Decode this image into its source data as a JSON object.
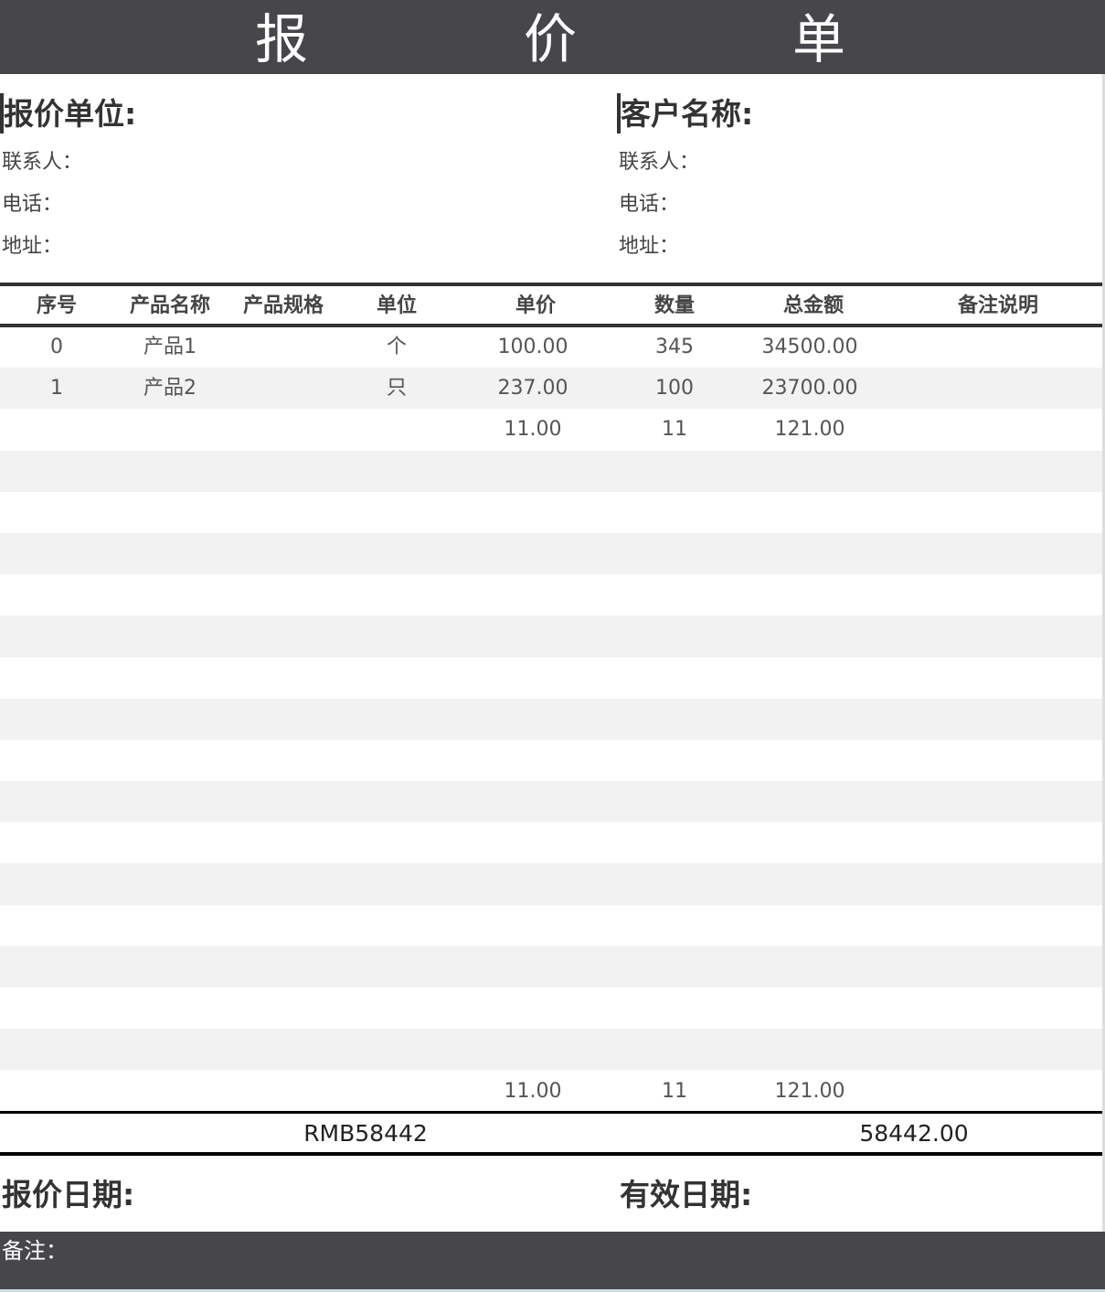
{
  "title": {
    "chars": [
      "报",
      "价",
      "单"
    ]
  },
  "quoter": {
    "heading": "报价单位:",
    "contact_label": "联系人：",
    "phone_label": "电话：",
    "address_label": "地址："
  },
  "customer": {
    "heading": "客户名称:",
    "contact_label": "联系人：",
    "phone_label": "电话：",
    "address_label": "地址："
  },
  "table": {
    "headers": {
      "index": "序号",
      "name": "产品名称",
      "spec": "产品规格",
      "unit": "单位",
      "price": "单价",
      "qty": "数量",
      "amount": "总金额",
      "notes": "备注说明"
    },
    "rows": [
      {
        "index": "0",
        "name": "产品1",
        "spec": "",
        "unit": "个",
        "price": "100.00",
        "qty": "345",
        "amount": "34500.00",
        "notes": ""
      },
      {
        "index": "1",
        "name": "产品2",
        "spec": "",
        "unit": "只",
        "price": "237.00",
        "qty": "100",
        "amount": "23700.00",
        "notes": ""
      },
      {
        "index": "",
        "name": "",
        "spec": "",
        "unit": "",
        "price": "11.00",
        "qty": "11",
        "amount": "121.00",
        "notes": ""
      },
      {
        "index": "",
        "name": "",
        "spec": "",
        "unit": "",
        "price": "",
        "qty": "",
        "amount": "",
        "notes": ""
      },
      {
        "index": "",
        "name": "",
        "spec": "",
        "unit": "",
        "price": "",
        "qty": "",
        "amount": "",
        "notes": ""
      },
      {
        "index": "",
        "name": "",
        "spec": "",
        "unit": "",
        "price": "",
        "qty": "",
        "amount": "",
        "notes": ""
      },
      {
        "index": "",
        "name": "",
        "spec": "",
        "unit": "",
        "price": "",
        "qty": "",
        "amount": "",
        "notes": ""
      },
      {
        "index": "",
        "name": "",
        "spec": "",
        "unit": "",
        "price": "",
        "qty": "",
        "amount": "",
        "notes": ""
      },
      {
        "index": "",
        "name": "",
        "spec": "",
        "unit": "",
        "price": "",
        "qty": "",
        "amount": "",
        "notes": ""
      },
      {
        "index": "",
        "name": "",
        "spec": "",
        "unit": "",
        "price": "",
        "qty": "",
        "amount": "",
        "notes": ""
      },
      {
        "index": "",
        "name": "",
        "spec": "",
        "unit": "",
        "price": "",
        "qty": "",
        "amount": "",
        "notes": ""
      },
      {
        "index": "",
        "name": "",
        "spec": "",
        "unit": "",
        "price": "",
        "qty": "",
        "amount": "",
        "notes": ""
      },
      {
        "index": "",
        "name": "",
        "spec": "",
        "unit": "",
        "price": "",
        "qty": "",
        "amount": "",
        "notes": ""
      },
      {
        "index": "",
        "name": "",
        "spec": "",
        "unit": "",
        "price": "",
        "qty": "",
        "amount": "",
        "notes": ""
      },
      {
        "index": "",
        "name": "",
        "spec": "",
        "unit": "",
        "price": "",
        "qty": "",
        "amount": "",
        "notes": ""
      },
      {
        "index": "",
        "name": "",
        "spec": "",
        "unit": "",
        "price": "",
        "qty": "",
        "amount": "",
        "notes": ""
      },
      {
        "index": "",
        "name": "",
        "spec": "",
        "unit": "",
        "price": "",
        "qty": "",
        "amount": "",
        "notes": ""
      },
      {
        "index": "",
        "name": "",
        "spec": "",
        "unit": "",
        "price": "",
        "qty": "",
        "amount": "",
        "notes": ""
      }
    ],
    "subtotal": {
      "price": "11.00",
      "qty": "11",
      "amount": "121.00"
    }
  },
  "total": {
    "words": "RMB58442",
    "amount": "58442.00"
  },
  "dates": {
    "quote_label": "报价日期:",
    "valid_label": "有效日期:"
  },
  "footer": {
    "notes_label": "备注："
  },
  "colors": {
    "bar": "#47464a",
    "stripe": "#f2f2f2",
    "rule": "#333333"
  }
}
